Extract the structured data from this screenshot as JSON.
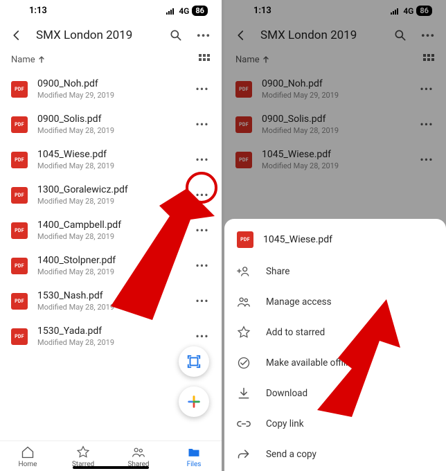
{
  "status": {
    "time": "1:13",
    "network": "4G",
    "battery": "86"
  },
  "header": {
    "title": "SMX London 2019"
  },
  "sort": {
    "label": "Name"
  },
  "files": [
    {
      "name": "0900_Noh.pdf",
      "meta": "Modified May 29, 2019"
    },
    {
      "name": "0900_Solis.pdf",
      "meta": "Modified May 28, 2019"
    },
    {
      "name": "1045_Wiese.pdf",
      "meta": "Modified May 28, 2019"
    },
    {
      "name": "1300_Goralewicz.pdf",
      "meta": "Modified May 28, 2019"
    },
    {
      "name": "1400_Campbell.pdf",
      "meta": "Modified May 28, 2019"
    },
    {
      "name": "1400_Stolpner.pdf",
      "meta": "Modified May 28, 2019"
    },
    {
      "name": "1530_Nash.pdf",
      "meta": "Modified May 28, 2019"
    },
    {
      "name": "1530_Yada.pdf",
      "meta": "Modified May 28, 2019"
    }
  ],
  "nav": {
    "home": "Home",
    "starred": "Starred",
    "shared": "Shared",
    "files": "Files"
  },
  "sheet": {
    "file": "1045_Wiese.pdf",
    "share": "Share",
    "manage": "Manage access",
    "star": "Add to starred",
    "offline": "Make available offline",
    "download": "Download",
    "copylink": "Copy link",
    "sendcopy": "Send a copy"
  },
  "pdf_label": "PDF",
  "colors": {
    "accent": "#1a73e8",
    "danger": "#d90000",
    "pdf": "#d93025"
  }
}
